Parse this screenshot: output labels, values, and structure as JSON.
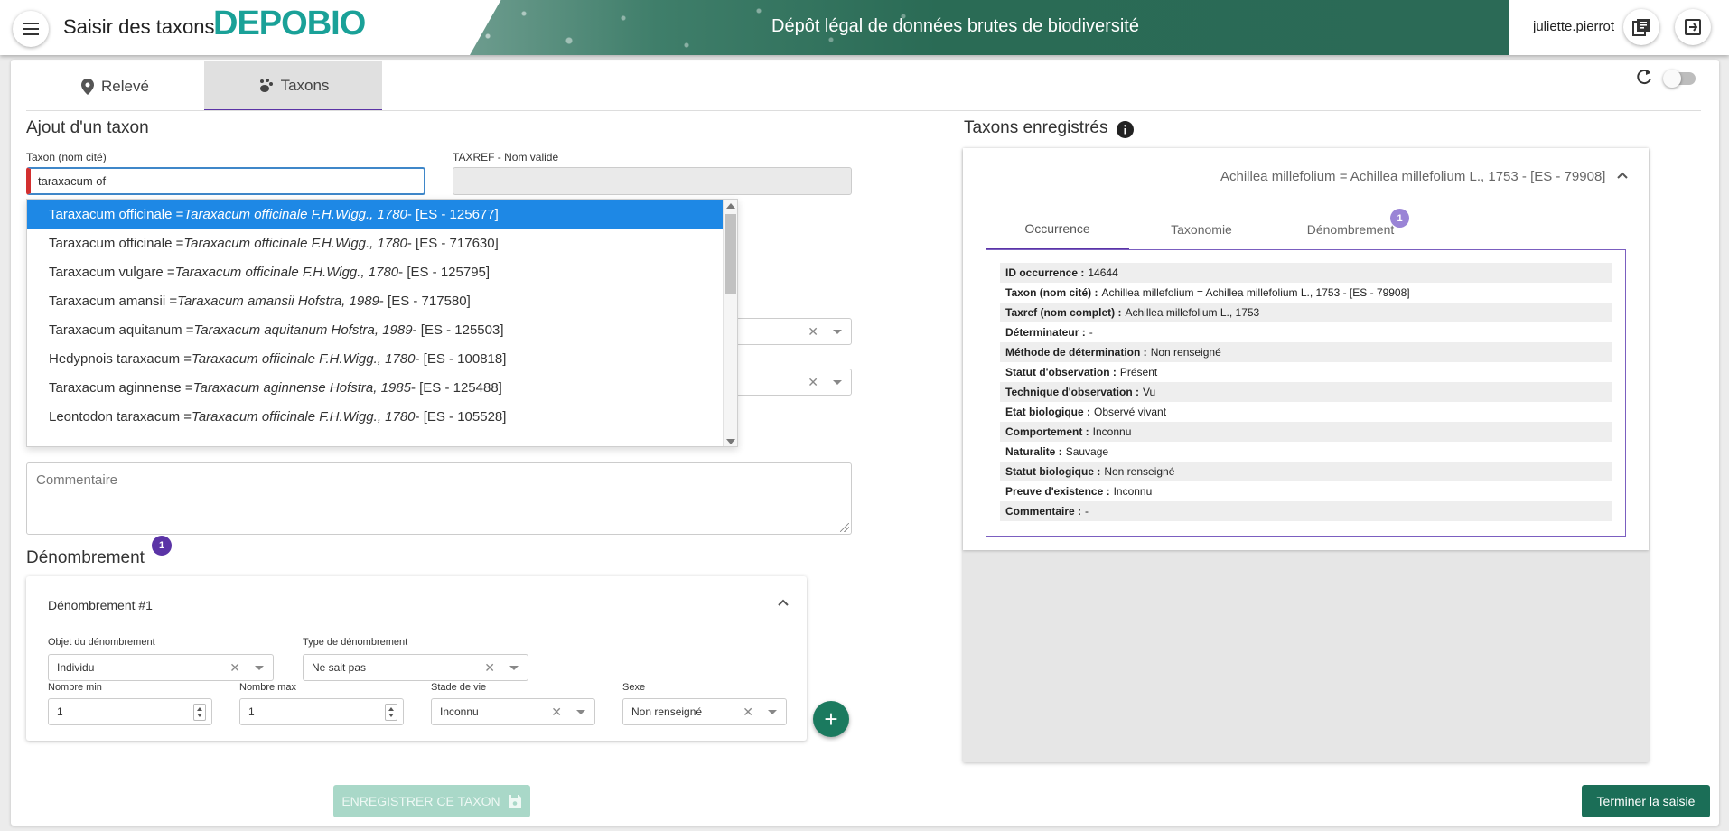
{
  "header": {
    "app_title": "Saisir des taxons",
    "brand": "DEPOBIO",
    "banner_title": "Dépôt légal de données brutes de biodiversité",
    "user": "juliette.pierrot"
  },
  "tabs": [
    {
      "label": "Relevé",
      "icon": "map-marker-icon"
    },
    {
      "label": "Taxons",
      "icon": "paw-icon"
    }
  ],
  "form": {
    "section_title": "Ajout d'un taxon",
    "taxon_label": "Taxon (nom cité)",
    "taxon_value": "taraxacum of",
    "taxref_label": "TAXREF - Nom valide",
    "taxref_value": "",
    "comment_placeholder": "Commentaire"
  },
  "autocomplete": [
    {
      "name": "Taraxacum officinale = ",
      "valid": "Taraxacum officinale F.H.Wigg., 1780",
      "code": " - [ES - 125677]"
    },
    {
      "name": "Taraxacum officinale = ",
      "valid": "Taraxacum officinale F.H.Wigg., 1780",
      "code": " - [ES - 717630]"
    },
    {
      "name": "Taraxacum vulgare = ",
      "valid": "Taraxacum officinale F.H.Wigg., 1780",
      "code": " - [ES - 125795]"
    },
    {
      "name": "Taraxacum amansii = ",
      "valid": "Taraxacum amansii Hofstra, 1989",
      "code": " - [ES - 717580]"
    },
    {
      "name": "Taraxacum aquitanum = ",
      "valid": "Taraxacum aquitanum Hofstra, 1989",
      "code": " - [ES - 125503]"
    },
    {
      "name": "Hedypnois taraxacum = ",
      "valid": "Taraxacum officinale F.H.Wigg., 1780",
      "code": " - [ES - 100818]"
    },
    {
      "name": "Taraxacum aginnense = ",
      "valid": "Taraxacum aginnense Hofstra, 1985",
      "code": " - [ES - 125488]"
    },
    {
      "name": "Leontodon taraxacum = ",
      "valid": "Taraxacum officinale F.H.Wigg., 1780",
      "code": " - [ES - 105528]"
    }
  ],
  "denombrement": {
    "title": "Dénombrement",
    "count": "1",
    "card_title": "Dénombrement #1",
    "objet_label": "Objet du dénombrement",
    "objet_value": "Individu",
    "type_label": "Type de dénombrement",
    "type_value": "Ne sait pas",
    "min_label": "Nombre min",
    "min_value": "1",
    "max_label": "Nombre max",
    "max_value": "1",
    "stade_label": "Stade de vie",
    "stade_value": "Inconnu",
    "sexe_label": "Sexe",
    "sexe_value": "Non renseigné"
  },
  "buttons": {
    "save": "ENREGISTRER CE TAXON",
    "finish": "Terminer la saisie",
    "add": "+"
  },
  "registered": {
    "title": "Taxons enregistrés",
    "taxon_header": "Achillea millefolium = Achillea millefolium L., 1753 - [ES - 79908]",
    "tabs": [
      "Occurrence",
      "Taxonomie",
      "Dénombrement"
    ],
    "tab_badge": "1",
    "rows": [
      {
        "label": "ID occurrence :",
        "value": "14644"
      },
      {
        "label": "Taxon (nom cité) :",
        "value": "Achillea millefolium = Achillea millefolium L., 1753 - [ES - 79908]"
      },
      {
        "label": "Taxref (nom complet) :",
        "value": "Achillea millefolium L., 1753"
      },
      {
        "label": "Déterminateur :",
        "value": "-"
      },
      {
        "label": "Méthode de détermination :",
        "value": "Non renseigné"
      },
      {
        "label": "Statut d'observation :",
        "value": "Présent"
      },
      {
        "label": "Technique d'observation :",
        "value": "Vu"
      },
      {
        "label": "Etat biologique :",
        "value": "Observé vivant"
      },
      {
        "label": "Comportement :",
        "value": "Inconnu"
      },
      {
        "label": "Naturalite :",
        "value": "Sauvage"
      },
      {
        "label": "Statut biologique :",
        "value": "Non renseigné"
      },
      {
        "label": "Preuve d'existence :",
        "value": "Inconnu"
      },
      {
        "label": "Commentaire :",
        "value": "-"
      }
    ]
  },
  "colors": {
    "accent": "#5b34a6",
    "brand": "#1aa198",
    "primary_green": "#1b6e57",
    "selection_blue": "#1e88e5"
  }
}
